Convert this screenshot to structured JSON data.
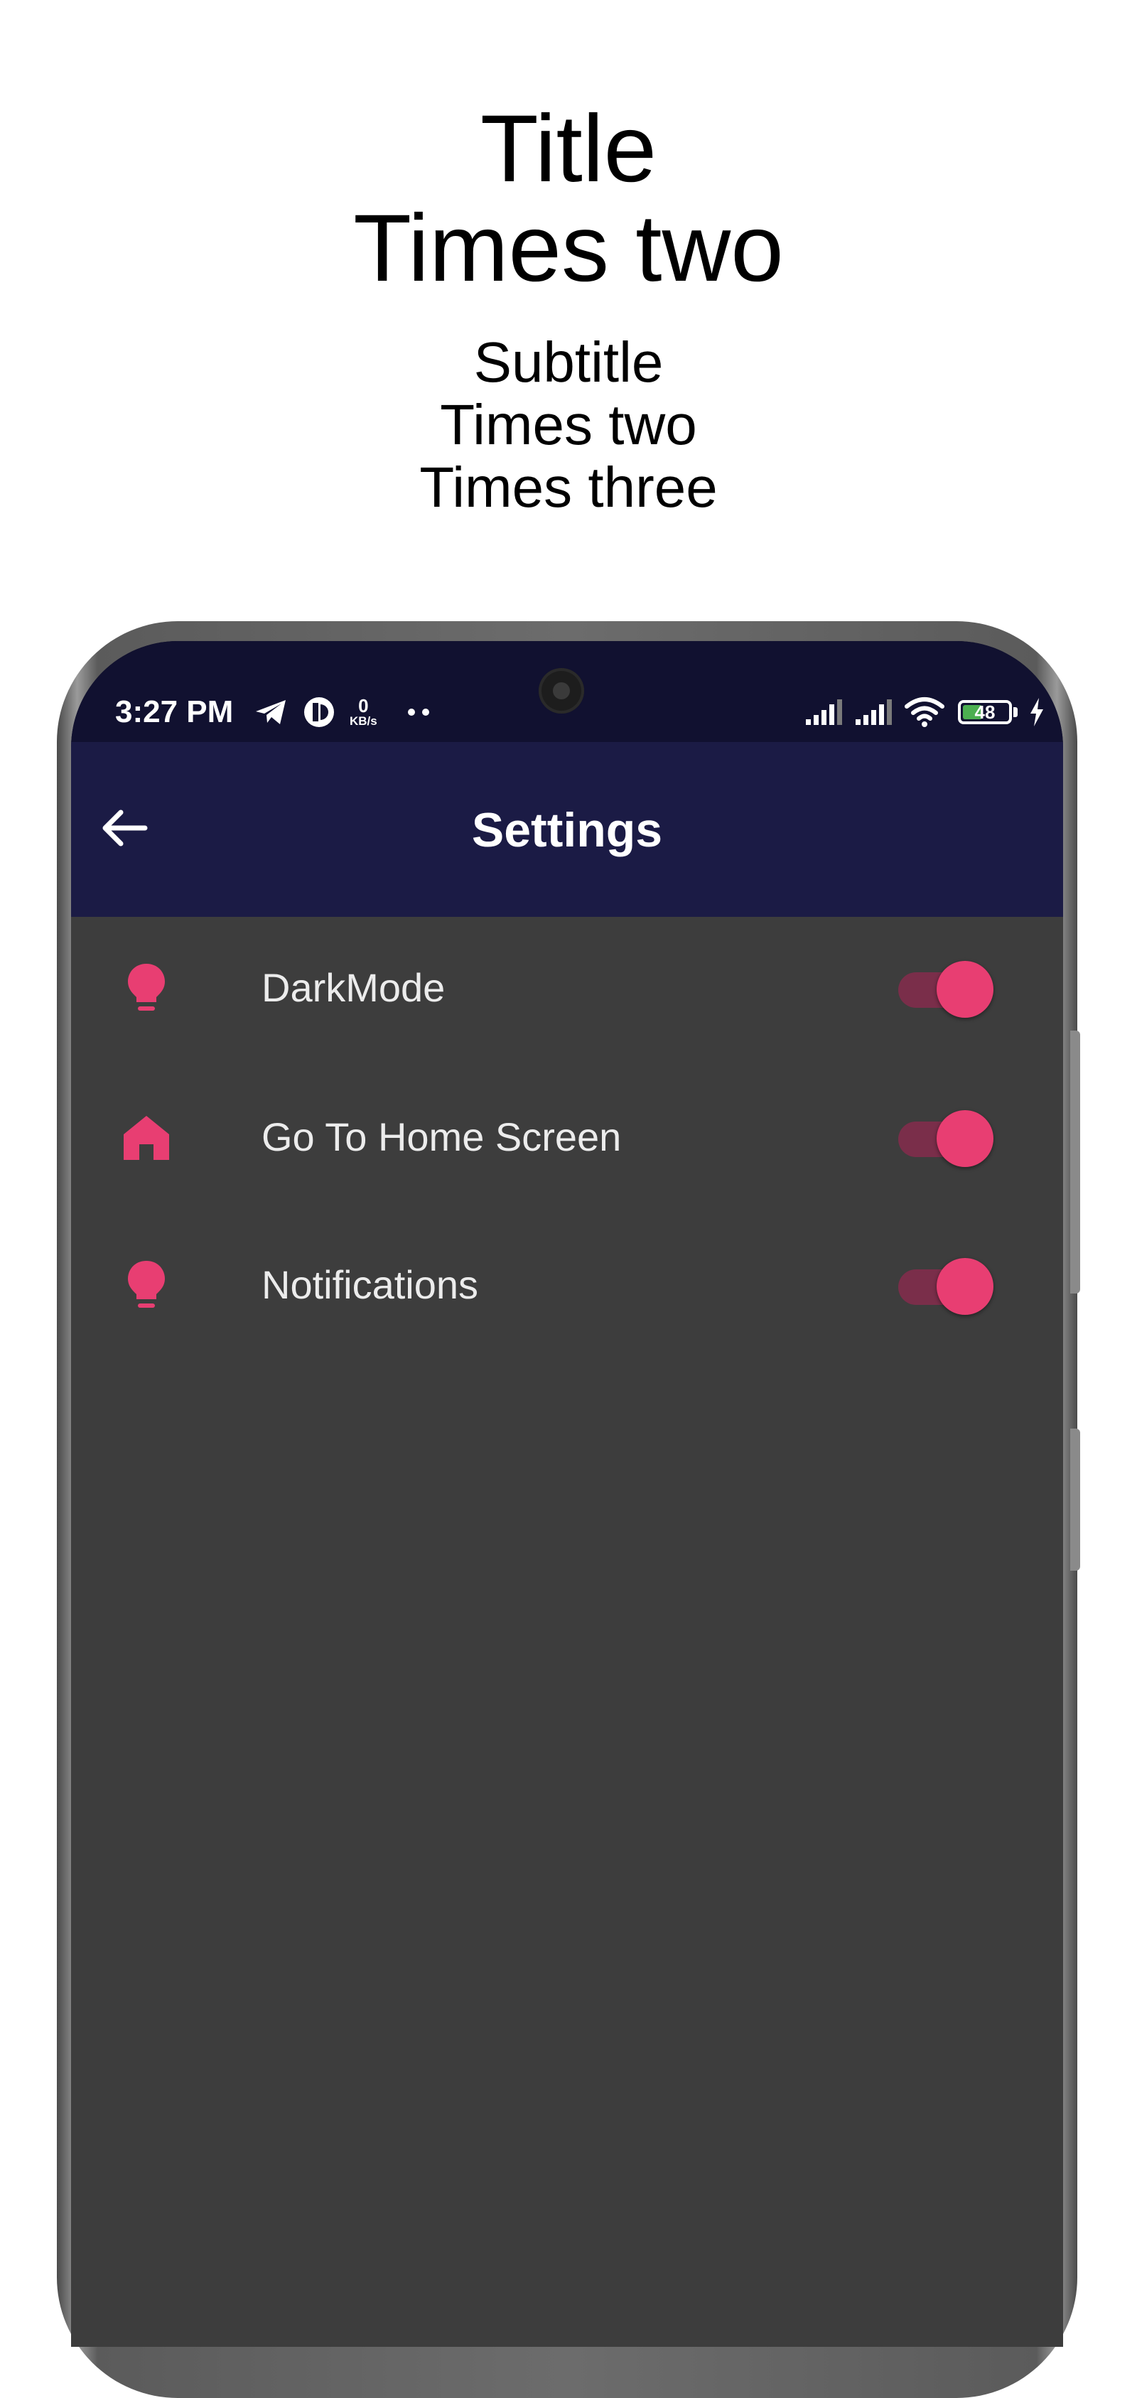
{
  "promo": {
    "title_lines": [
      "Title",
      "Times two"
    ],
    "subtitle_lines": [
      "Subtitle",
      "Times two",
      "Times three"
    ]
  },
  "status_bar": {
    "time": "3:27 PM",
    "network_speed_value": "0",
    "network_speed_unit": "KB/s",
    "battery_level": "48",
    "icons": [
      "telegram-icon",
      "app-notification-icon",
      "more-notifications-icon",
      "signal-icon",
      "signal-icon",
      "wifi-icon",
      "battery-icon",
      "charging-icon"
    ]
  },
  "app_bar": {
    "back_icon": "arrow-left-icon",
    "title": "Settings"
  },
  "settings": [
    {
      "label": "DarkMode",
      "icon": "lightbulb-icon",
      "enabled": true
    },
    {
      "label": "Go To Home Screen",
      "icon": "home-icon",
      "enabled": true
    },
    {
      "label": "Notifications",
      "icon": "lightbulb-icon",
      "enabled": true
    }
  ],
  "colors": {
    "accent": "#e83e72",
    "toggle_track": "#7a2e4a",
    "app_bar": "#1b1b45",
    "status_bar": "#111130",
    "content_background": "#3d3d3d",
    "text_light": "#ececec",
    "battery_fill": "#4caf50"
  }
}
